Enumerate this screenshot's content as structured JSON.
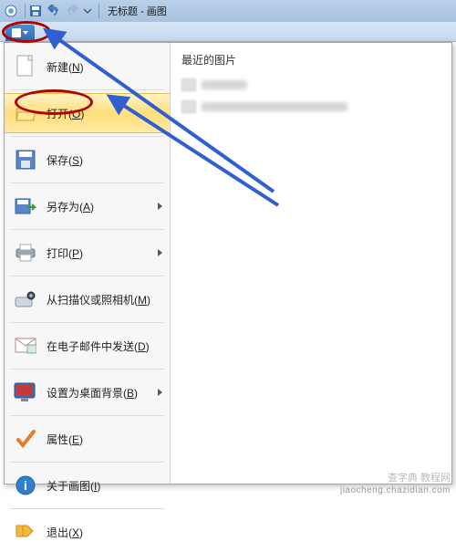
{
  "titlebar": {
    "title": "无标题 - 画图"
  },
  "menu": {
    "recent_header": "最近的图片",
    "items": [
      {
        "label": "新建(N)",
        "submenu": false
      },
      {
        "label": "打开(O)",
        "submenu": false,
        "highlight": true
      },
      {
        "label": "保存(S)",
        "submenu": false
      },
      {
        "label": "另存为(A)",
        "submenu": true
      },
      {
        "label": "打印(P)",
        "submenu": true
      },
      {
        "label": "从扫描仪或照相机(M)",
        "submenu": false
      },
      {
        "label": "在电子邮件中发送(D)",
        "submenu": false
      },
      {
        "label": "设置为桌面背景(B)",
        "submenu": true
      },
      {
        "label": "属性(E)",
        "submenu": false
      },
      {
        "label": "关于画图(I)",
        "submenu": false
      },
      {
        "label": "退出(X)",
        "submenu": false
      }
    ]
  },
  "watermark": {
    "line1": "查字典 教程网",
    "line2": "jiaocheng.chazidian.com"
  }
}
